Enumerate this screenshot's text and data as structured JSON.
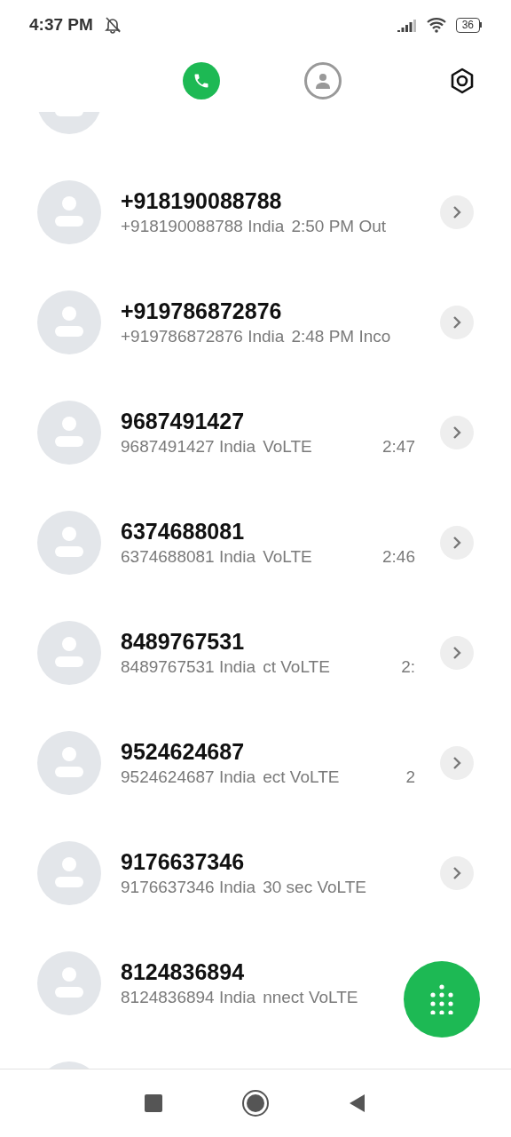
{
  "status_bar": {
    "time": "4:37 PM",
    "battery": "36"
  },
  "tabs": [
    {
      "kind": "calls",
      "selected": true
    },
    {
      "kind": "contacts",
      "selected": false
    }
  ],
  "calls": [
    {
      "name": "+918190088788",
      "segments": [
        "+918190088788 India",
        "2:50 PM Out"
      ],
      "chevron": true
    },
    {
      "name": "+919786872876",
      "segments": [
        "+919786872876 India",
        "2:48 PM Inco"
      ],
      "chevron": true
    },
    {
      "name": "9687491427",
      "segments": [
        "9687491427 India",
        "VoLTE"
      ],
      "time": "2:47",
      "chevron": true
    },
    {
      "name": "6374688081",
      "segments": [
        "6374688081 India",
        "VoLTE"
      ],
      "time": "2:46",
      "chevron": true
    },
    {
      "name": "8489767531",
      "segments": [
        "8489767531 India",
        "ct VoLTE"
      ],
      "time": "2:",
      "chevron": true
    },
    {
      "name": "9524624687",
      "segments": [
        "9524624687 India",
        "ect VoLTE"
      ],
      "time": "2",
      "chevron": true
    },
    {
      "name": "9176637346",
      "segments": [
        "9176637346 India",
        "30 sec VoLTE"
      ],
      "chevron": true
    },
    {
      "name": "8124836894",
      "segments": [
        "8124836894 India",
        "nnect VoLTE"
      ],
      "chevron": false
    }
  ]
}
